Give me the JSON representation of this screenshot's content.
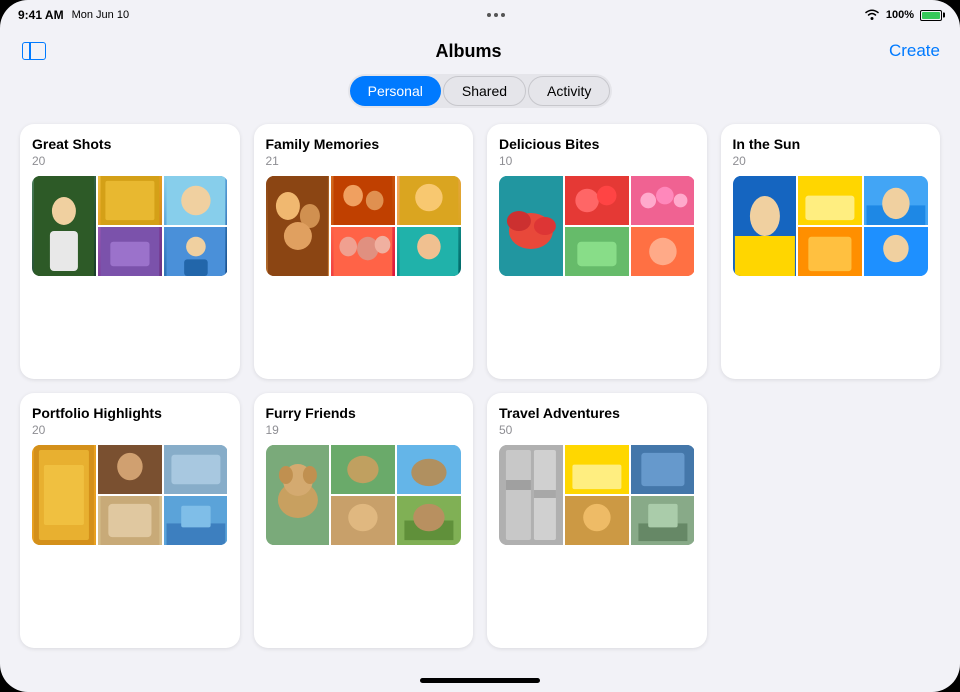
{
  "statusBar": {
    "time": "9:41 AM",
    "date": "Mon Jun 10",
    "battery": "100%"
  },
  "header": {
    "title": "Albums",
    "createLabel": "Create"
  },
  "tabs": [
    {
      "id": "personal",
      "label": "Personal",
      "active": true
    },
    {
      "id": "shared",
      "label": "Shared",
      "active": false
    },
    {
      "id": "activity",
      "label": "Activity",
      "active": false
    }
  ],
  "albums": [
    {
      "id": "great-shots",
      "title": "Great Shots",
      "count": "20",
      "photos": [
        "photo-green",
        "photo-yellow",
        "photo-blue-sky",
        "photo-purple",
        "photo-person-blue"
      ]
    },
    {
      "id": "family-memories",
      "title": "Family Memories",
      "count": "21",
      "photos": [
        "photo-family1",
        "photo-family2",
        "photo-family3",
        "photo-family4",
        "photo-family5"
      ]
    },
    {
      "id": "delicious-bites",
      "title": "Delicious Bites",
      "count": "10",
      "photos": [
        "photo-food1",
        "photo-food2",
        "photo-food3",
        "photo-food4",
        "photo-food5"
      ]
    },
    {
      "id": "in-the-sun",
      "title": "In the Sun",
      "count": "20",
      "photos": [
        "photo-sun1",
        "photo-sun2",
        "photo-sun3",
        "photo-sun4",
        "photo-sun3"
      ]
    },
    {
      "id": "portfolio-highlights",
      "title": "Portfolio Highlights",
      "count": "20",
      "photos": [
        "photo-port1",
        "photo-port2",
        "photo-port3",
        "photo-port4",
        "photo-port5"
      ]
    },
    {
      "id": "furry-friends",
      "title": "Furry Friends",
      "count": "19",
      "photos": [
        "photo-dog1",
        "photo-dog2",
        "photo-dog3",
        "photo-dog4",
        "photo-dog5"
      ]
    },
    {
      "id": "travel-adventures",
      "title": "Travel Adventures",
      "count": "50",
      "photos": [
        "photo-travel1",
        "photo-travel2",
        "photo-travel3",
        "photo-travel4",
        "photo-travel5"
      ]
    }
  ]
}
